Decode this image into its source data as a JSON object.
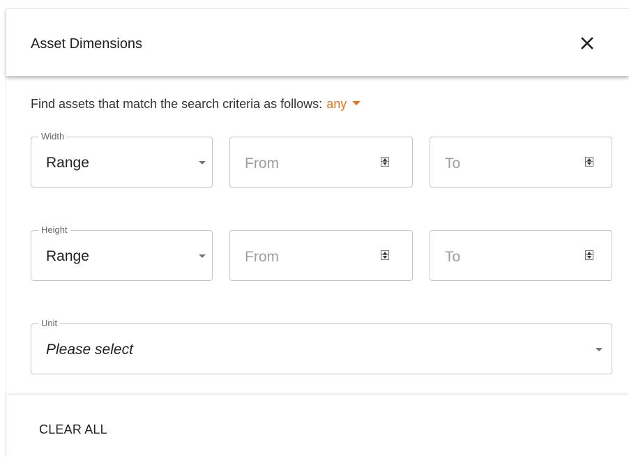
{
  "dialog": {
    "title": "Asset Dimensions",
    "close_icon": "close-icon"
  },
  "criteria": {
    "text": "Find assets that match the search criteria as follows:",
    "match_value": "any",
    "match_caret_icon": "caret-down-icon",
    "accent_color": "#e8731c"
  },
  "width": {
    "legend": "Width",
    "mode_value": "Range",
    "from_placeholder": "From",
    "to_placeholder": "To"
  },
  "height": {
    "legend": "Height",
    "mode_value": "Range",
    "from_placeholder": "From",
    "to_placeholder": "To"
  },
  "unit": {
    "legend": "Unit",
    "value": "Please select"
  },
  "footer": {
    "clear_all_label": "CLEAR ALL"
  }
}
